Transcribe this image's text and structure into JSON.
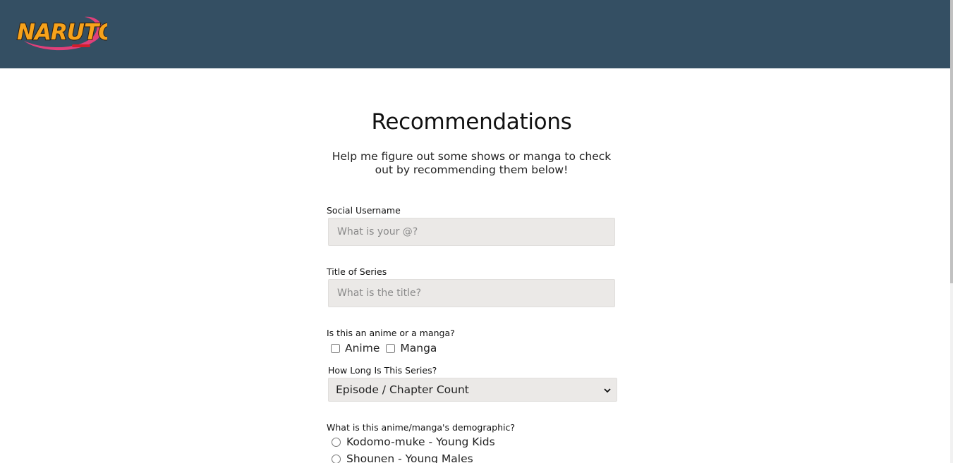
{
  "header": {
    "logo_text": "NARUTO",
    "background": "#344f63"
  },
  "main": {
    "title": "Recommendations",
    "subtitle": "Help me figure out some shows or manga to check out by recommending them below!"
  },
  "form": {
    "username": {
      "label": "Social Username",
      "placeholder": "What is your @?",
      "value": ""
    },
    "series_title": {
      "label": "Title of Series",
      "placeholder": "What is the title?",
      "value": ""
    },
    "type": {
      "label": "Is this an anime or a manga?",
      "options": [
        "Anime",
        "Manga"
      ]
    },
    "length": {
      "label": "How Long Is This Series?",
      "selected": "Episode / Chapter Count"
    },
    "demographic": {
      "label": "What is this anime/manga's demographic?",
      "options": [
        "Kodomo-muke - Young Kids",
        "Shounen - Young Males"
      ]
    }
  },
  "colors": {
    "accent": "#344f63",
    "input_bg": "#ebe9e7"
  },
  "icons": {
    "select_arrow": "chevron-down-icon"
  }
}
